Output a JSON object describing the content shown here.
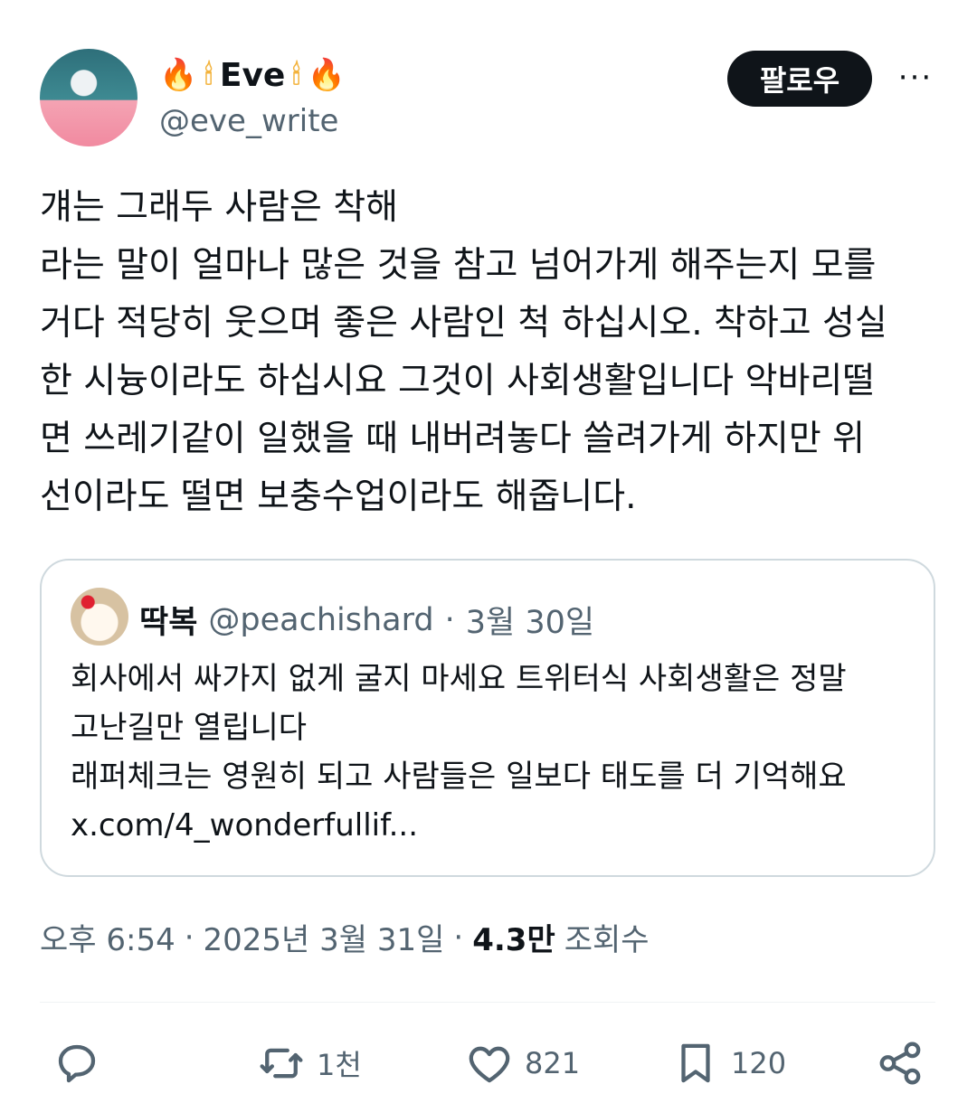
{
  "author": {
    "display_name": "Eve",
    "name_emojis": {
      "fire": "🔥",
      "candle": "🕯"
    },
    "handle": "@eve_write"
  },
  "follow_button": "팔로우",
  "more_icon": "···",
  "tweet_lines": [
    "걔는 그래두 사람은 착해",
    "라는 말이 얼마나 많은 것을 참고 넘어가게 해주는지 모를",
    "거다 적당히 웃으며 좋은 사람인 척 하십시오. 착하고 성실",
    "한 시늉이라도 하십시요 그것이 사회생활입니다 악바리떨",
    "면 쓰레기같이 일했을 때 내버려놓다 쓸려가게 하지만 위",
    "선이라도 떨면 보충수업이라도 해줍니다."
  ],
  "quote": {
    "name": "딱복",
    "handle": "@peachishard",
    "separator": "·",
    "date": "3월 30일",
    "lines": [
      "회사에서 싸가지 없게 굴지 마세요 트위터식 사회생활은 정말",
      "고난길만 열립니다",
      "래퍼체크는 영원히 되고 사람들은 일보다 태도를 더 기억해요",
      "x.com/4_wonderfullif..."
    ]
  },
  "meta": {
    "time": "오후 6:54",
    "separator": "·",
    "date": "2025년 3월 31일",
    "views_count": "4.3만",
    "views_label": "조회수"
  },
  "actions": {
    "reply_count": "",
    "retweet_count": "1천",
    "like_count": "821",
    "bookmark_count": "120"
  },
  "colors": {
    "text": "#0f1419",
    "muted": "#536471",
    "border": "#cfd9de",
    "follow_bg": "#0f1419"
  }
}
